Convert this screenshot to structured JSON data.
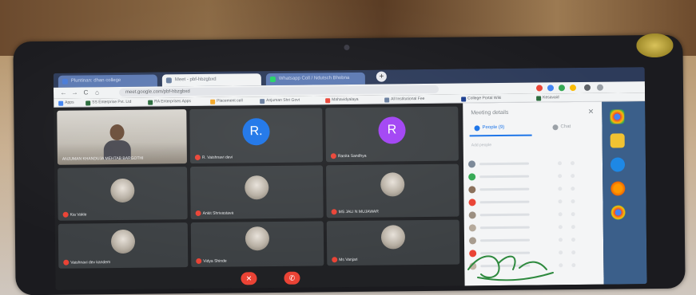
{
  "browser": {
    "tabs": [
      {
        "label": "Pluntinan: dhan college"
      },
      {
        "label": "Meet - pbf-hbzgbxd"
      },
      {
        "label": "Whatsapp Coll / Ndutsch Bhobna"
      }
    ],
    "new_tab_label": "+",
    "url": "meet.google.com/pbf-hbzgbxd",
    "nav": {
      "back": "←",
      "forward": "→",
      "reload": "C",
      "home": "⌂"
    },
    "bookmarks": [
      "Apps",
      "SS Enterprise Pvt. Ltd",
      "RA Enterprises Apps",
      "Placement cell",
      "Anjuman Shri Govt",
      "Mahavidyalaya",
      "All Institutional Fee",
      "College Portal Wiki",
      "Kesavaid"
    ]
  },
  "meet": {
    "participants": [
      {
        "name": "ANJUMAN KHANDUJA MEHTAB BARGOTHI",
        "type": "video"
      },
      {
        "name": "R. Vaishnavi devi",
        "type": "letter",
        "letter": "R.",
        "color": "#1a73e8"
      },
      {
        "name": "Ranita Sandhya",
        "type": "letter",
        "letter": "R",
        "color": "#a142f4"
      },
      {
        "name": "Kia Vakle",
        "type": "avatar"
      },
      {
        "name": "Ankit Shrivastava",
        "type": "avatar"
      },
      {
        "name": "MS JALI N MUJAWAR",
        "type": "avatar"
      },
      {
        "name": "Vaishnavi dev kandem",
        "type": "avatar"
      },
      {
        "name": "Vidya Shinde",
        "type": "avatar"
      },
      {
        "name": "Ms Vanjari",
        "type": "avatar"
      }
    ],
    "controls": {
      "mic": "✕",
      "hangup": "✆"
    }
  },
  "panel": {
    "title": "Meeting details",
    "close": "✕",
    "tab_people": "People (9)",
    "tab_chat": "Chat",
    "add_people": "Add people"
  },
  "colors": {
    "accent": "#1a73e8",
    "hangup": "#ea4335",
    "tile": "#3c4043",
    "taskbar": "#3b5f8a"
  },
  "taskbar": {
    "icons": [
      "chrome-icon",
      "folder-icon",
      "edge-icon",
      "firefox-icon",
      "chrome-icon"
    ]
  }
}
